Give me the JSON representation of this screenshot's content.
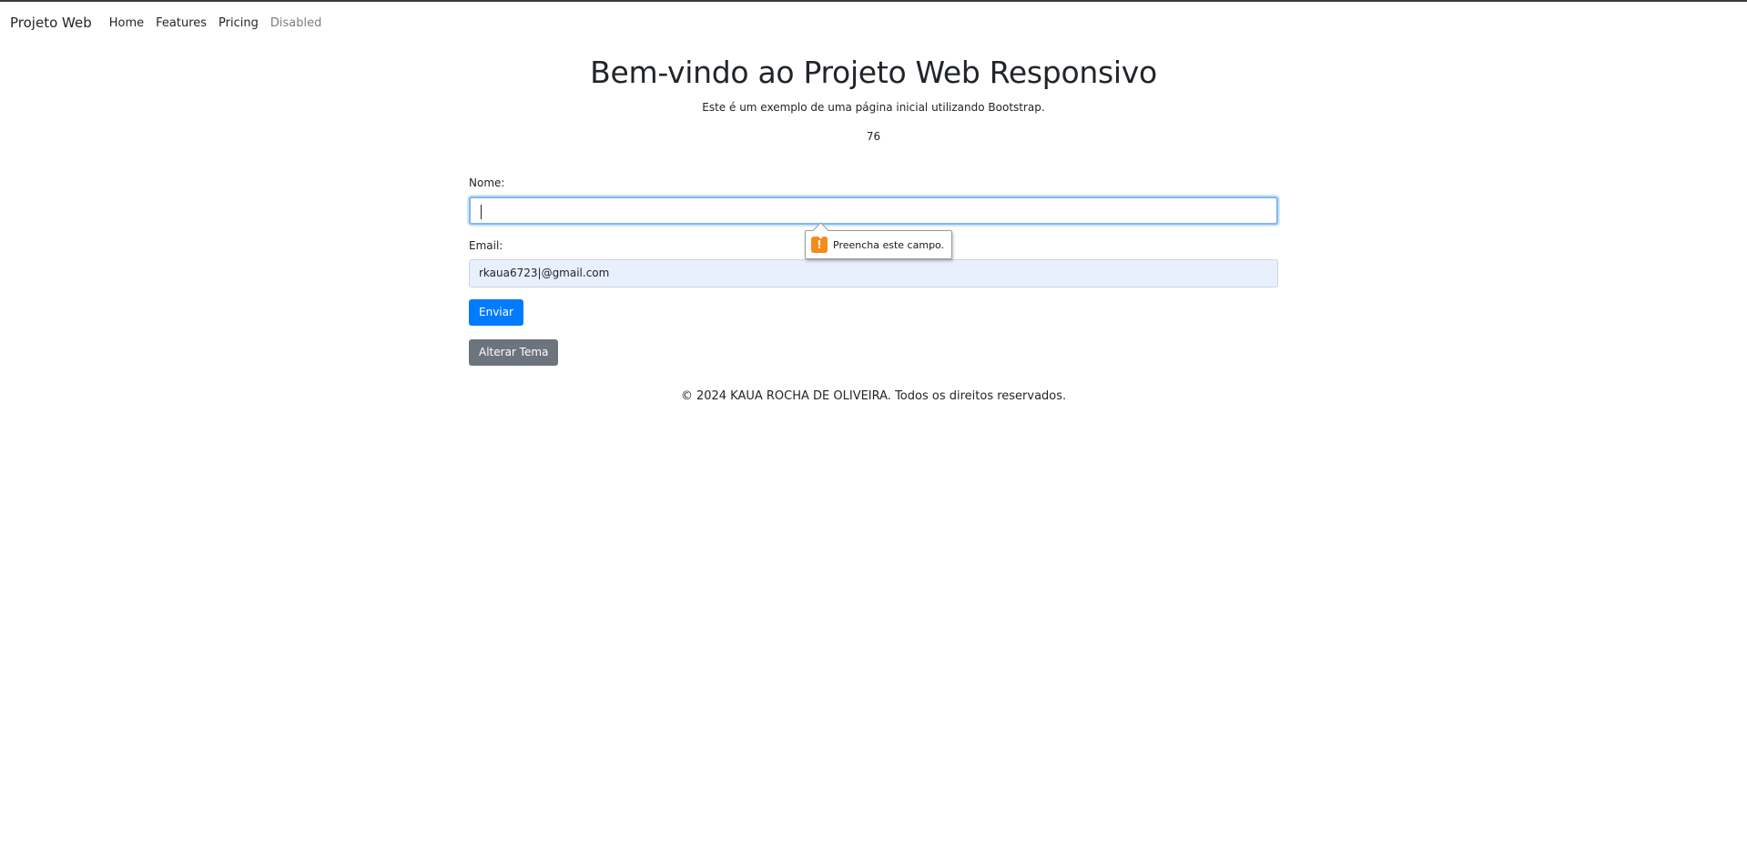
{
  "navbar": {
    "brand": "Projeto Web",
    "links": [
      {
        "label": "Home"
      },
      {
        "label": "Features"
      },
      {
        "label": "Pricing"
      },
      {
        "label": "Disabled"
      }
    ]
  },
  "hero": {
    "title": "Bem-vindo ao Projeto Web Responsivo",
    "subtitle": "Este é um exemplo de uma página inicial utilizando Bootstrap.",
    "counter": "76"
  },
  "form": {
    "nome_label": "Nome:",
    "nome_value": "",
    "email_label": "Email:",
    "email_value": "rkaua6723|@gmail.com",
    "submit_label": "Enviar",
    "theme_label": "Alterar Tema"
  },
  "validation": {
    "message": "Preencha este campo.",
    "icon": "warning-icon",
    "icon_glyph": "!"
  },
  "footer": {
    "text": "© 2024 KAUA ROCHA DE OLIVEIRA. Todos os direitos reservados."
  },
  "colors": {
    "primary": "#007bff",
    "secondary": "#6c757d",
    "focus_border": "#80b6f0",
    "autofill_bg": "#e8f0fe",
    "warning": "#f28c1a"
  }
}
